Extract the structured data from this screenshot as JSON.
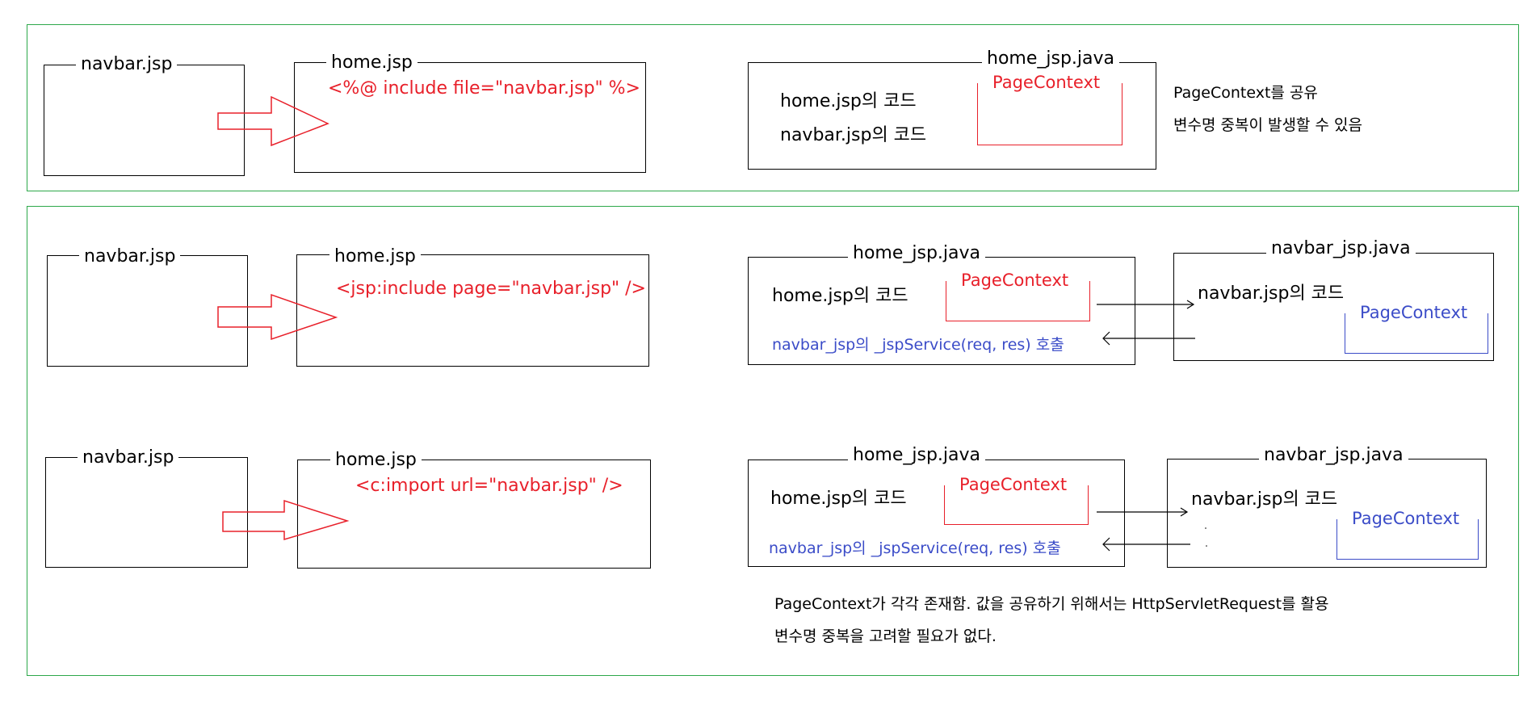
{
  "section1": {
    "navbar_box": {
      "label": "navbar.jsp"
    },
    "home_box": {
      "label": "home.jsp",
      "code": "<%@ include file=\"navbar.jsp\" %>"
    },
    "java_box": {
      "label": "home_jsp.java",
      "line1": "home.jsp의 코드",
      "line2": "navbar.jsp의 코드",
      "context": "PageContext"
    },
    "note": {
      "line1": "PageContext를 공유",
      "line2": "변수명 중복이 발생할 수 있음"
    }
  },
  "section2": {
    "row1": {
      "navbar_box": {
        "label": "navbar.jsp"
      },
      "home_box": {
        "label": "home.jsp",
        "code": "<jsp:include page=\"navbar.jsp\" />"
      },
      "home_java": {
        "label": "home_jsp.java",
        "line1": "home.jsp의 코드",
        "context": "PageContext",
        "call": "navbar_jsp의 _jspService(req, res) 호출"
      },
      "navbar_java": {
        "label": "navbar_jsp.java",
        "line1": "navbar.jsp의 코드",
        "context": "PageContext"
      }
    },
    "row2": {
      "navbar_box": {
        "label": "navbar.jsp"
      },
      "home_box": {
        "label": "home.jsp",
        "code": "<c:import url=\"navbar.jsp\" />"
      },
      "home_java": {
        "label": "home_jsp.java",
        "line1": "home.jsp의 코드",
        "context": "PageContext",
        "call": "navbar_jsp의 _jspService(req, res) 호출"
      },
      "navbar_java": {
        "label": "navbar_jsp.java",
        "line1": "navbar.jsp의 코드",
        "context": "PageContext"
      }
    },
    "note": {
      "line1": "PageContext가 각각 존재함. 값을 공유하기 위해서는 HttpServletRequest를 활용",
      "line2": "변수명 중복을 고려할 필요가 없다."
    }
  },
  "colors": {
    "panel_border": "#2da84a",
    "code_red": "#e8202a",
    "call_blue": "#3b4cc8"
  }
}
